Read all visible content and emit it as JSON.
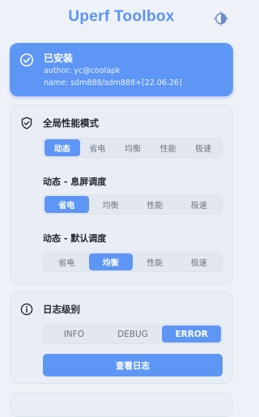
{
  "header": {
    "title": "Uperf Toolbox",
    "theme_icon": "theme-toggle-icon"
  },
  "installed": {
    "title": "已安装",
    "author": "author: yc@coolapk",
    "name": "name: sdm888/sdm888+[22.06.26]",
    "icon": "check-circle-icon"
  },
  "global_mode": {
    "title": "全局性能模式",
    "icon": "shield-icon",
    "options": [
      "动态",
      "省电",
      "均衡",
      "性能",
      "极速"
    ],
    "selected": "动态"
  },
  "screen_off": {
    "title": "动态 - 息屏调度",
    "options": [
      "省电",
      "均衡",
      "性能",
      "极速"
    ],
    "selected": "省电"
  },
  "default_sched": {
    "title": "动态 - 默认调度",
    "options": [
      "省电",
      "均衡",
      "性能",
      "极速"
    ],
    "selected": "均衡"
  },
  "log": {
    "title": "日志级别",
    "icon": "info-icon",
    "options": [
      "INFO",
      "DEBUG",
      "ERROR"
    ],
    "selected": "ERROR",
    "view_button": "查看日志"
  },
  "colors": {
    "accent": "#5e96f6",
    "background": "#eef2f8",
    "card": "#e9eef6"
  }
}
